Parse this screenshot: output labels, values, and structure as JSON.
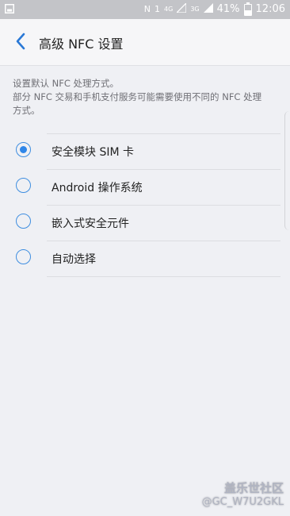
{
  "statusbar": {
    "left_icon": "image-icon",
    "nfc_glyph": "N",
    "sim_glyph": "1",
    "network_4g": "4G",
    "network_3g": "3G",
    "battery_text": "41%",
    "battery_level": 0.41,
    "time": "12:06"
  },
  "appbar": {
    "title": "高级 NFC 设置"
  },
  "description": {
    "line1": "设置默认 NFC 处理方式。",
    "line2": "部分 NFC 交易和手机支付服务可能需要使用不同的 NFC 处理",
    "line3": "方式。"
  },
  "options": [
    {
      "label": "安全模块 SIM 卡",
      "selected": true
    },
    {
      "label": "Android 操作系统",
      "selected": false
    },
    {
      "label": "嵌入式安全元件",
      "selected": false
    },
    {
      "label": "自动选择",
      "selected": false
    }
  ],
  "watermark": {
    "line1": "盖乐世社区",
    "line2": "@GC_W7U2GKL"
  },
  "colors": {
    "accent": "#2f86e8",
    "background": "#eff0f4",
    "statusbar": "#c3c4c8"
  }
}
